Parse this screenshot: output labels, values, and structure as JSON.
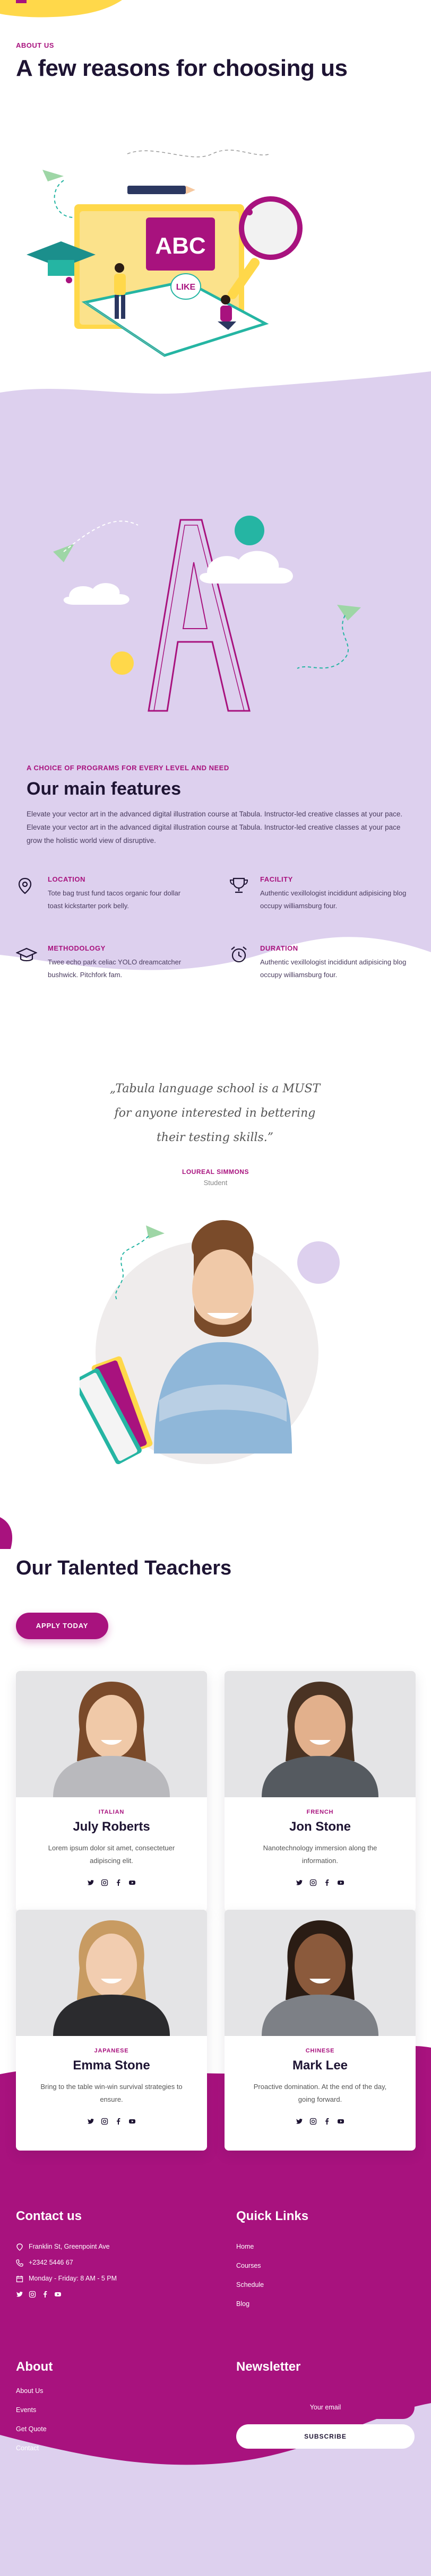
{
  "colors": {
    "brand": "#a8127e",
    "lavender": "#ddd0ee",
    "yellow": "#ffd84a",
    "dark": "#1e1433",
    "teal": "#25b5a3"
  },
  "about": {
    "tag": "ABOUT US",
    "title": "A few reasons for choosing us",
    "book_label": "ABC",
    "bubble_label": "LIKE"
  },
  "features_section": {
    "kicker": "A CHOICE OF PROGRAMS FOR EVERY LEVEL AND NEED",
    "title": "Our main features",
    "description": "Elevate your vector art in the advanced digital illustration course at Tabula. Instructor-led creative classes at your pace. Elevate your vector art in the advanced digital illustration course at Tabula. Instructor-led creative classes at your pace grow the holistic world view of disruptive.",
    "items": [
      {
        "title": "LOCATION",
        "text": "Tote bag trust fund tacos organic four dollar toast kickstarter pork belly.",
        "icon": "location-pin-icon"
      },
      {
        "title": "FACILITY",
        "text": "Authentic vexillologist incididunt adipisicing blog occupy williamsburg four.",
        "icon": "trophy-icon"
      },
      {
        "title": "METHODOLOGY",
        "text": "Twee echo park celiac YOLO dreamcatcher bushwick. Pitchfork fam.",
        "icon": "graduation-cap-icon"
      },
      {
        "title": "DURATION",
        "text": "Authentic vexillologist incididunt adipisicing blog occupy williamsburg four.",
        "icon": "alarm-clock-icon"
      }
    ]
  },
  "testimonial": {
    "lines": [
      "„Tabula language school is a MUST",
      "for anyone interested in bettering",
      "their testing skills.”"
    ],
    "name": "LOUREAL SIMMONS",
    "role": "Student"
  },
  "teachers": {
    "title": "Our Talented Teachers",
    "apply_label": "APPLY TODAY",
    "cards": [
      {
        "language": "ITALIAN",
        "name": "July Roberts",
        "desc": "Lorem ipsum dolor sit amet, consectetuer adipiscing elit.",
        "shirt": "#b9b9bd",
        "hair": "#7a4a2a",
        "skin": "#f0c9a8"
      },
      {
        "language": "FRENCH",
        "name": "Jon Stone",
        "desc": "Nanotechnology immersion along the information.",
        "shirt": "#555a60",
        "hair": "#4a3323",
        "skin": "#e2b08c"
      },
      {
        "language": "JAPANESE",
        "name": "Emma Stone",
        "desc": "Bring to the table win-win survival strategies to ensure.",
        "shirt": "#2b2b2e",
        "hair": "#c89b62",
        "skin": "#f2cdb0"
      },
      {
        "language": "CHINESE",
        "name": "Mark Lee",
        "desc": "Proactive domination. At the end of the day, going forward.",
        "shirt": "#7d8086",
        "hair": "#2a1c14",
        "skin": "#8b5a3c"
      }
    ]
  },
  "footer": {
    "contact": {
      "title": "Contact us",
      "address": "Franklin St, Greenpoint Ave",
      "phone": "+2342 5446 67",
      "hours": "Monday - Friday: 8 AM - 5 PM"
    },
    "quick_links": {
      "title": "Quick Links",
      "items": [
        "Home",
        "Courses",
        "Schedule",
        "Blog"
      ]
    },
    "about": {
      "title": "About",
      "items": [
        "About Us",
        "Events",
        "Get Quote",
        "Contact"
      ]
    },
    "newsletter": {
      "title": "Newsletter",
      "placeholder": "Your email",
      "button": "SUBSCRIBE"
    }
  }
}
